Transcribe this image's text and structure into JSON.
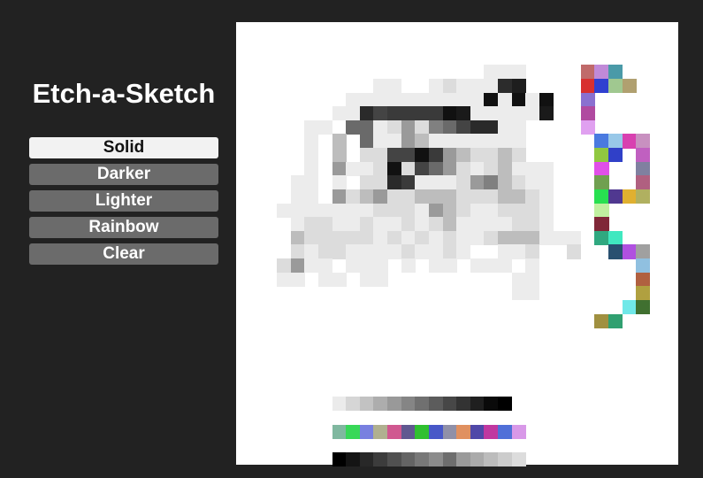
{
  "app": {
    "title": "Etch-a-Sketch"
  },
  "controls": {
    "buttons": [
      {
        "id": "solid",
        "label": "Solid",
        "active": true
      },
      {
        "id": "darker",
        "label": "Darker",
        "active": false
      },
      {
        "id": "lighter",
        "label": "Lighter",
        "active": false
      },
      {
        "id": "rainbow",
        "label": "Rainbow",
        "active": false
      },
      {
        "id": "clear",
        "label": "Clear",
        "active": false
      }
    ]
  },
  "colors": {
    "background": "#222222",
    "button": "#6b6b6b",
    "button_active": "#f2f2f2",
    "canvas": "#ffffff"
  },
  "grid": {
    "size": 32,
    "cells": [
      [
        15,
        2,
        "#ececec"
      ],
      [
        16,
        2,
        "#ececec"
      ],
      [
        17,
        2,
        "#ececec"
      ],
      [
        7,
        3,
        "#ececec"
      ],
      [
        8,
        3,
        "#ececec"
      ],
      [
        11,
        3,
        "#ececec"
      ],
      [
        12,
        3,
        "#dcdcdc"
      ],
      [
        13,
        3,
        "#ececec"
      ],
      [
        14,
        3,
        "#ececec"
      ],
      [
        15,
        3,
        "#ececec"
      ],
      [
        16,
        3,
        "#2c2c2c"
      ],
      [
        17,
        3,
        "#1e1e1e"
      ],
      [
        5,
        4,
        "#ececec"
      ],
      [
        6,
        4,
        "#ececec"
      ],
      [
        7,
        4,
        "#ececec"
      ],
      [
        8,
        4,
        "#ececec"
      ],
      [
        9,
        4,
        "#ececec"
      ],
      [
        10,
        4,
        "#ececec"
      ],
      [
        11,
        4,
        "#ececec"
      ],
      [
        12,
        4,
        "#ececec"
      ],
      [
        13,
        4,
        "#ececec"
      ],
      [
        14,
        4,
        "#ececec"
      ],
      [
        15,
        4,
        "#111111"
      ],
      [
        16,
        4,
        "#ececec"
      ],
      [
        17,
        4,
        "#111111"
      ],
      [
        18,
        4,
        "#ececec"
      ],
      [
        19,
        4,
        "#111111"
      ],
      [
        4,
        5,
        "#ececec"
      ],
      [
        5,
        5,
        "#ececec"
      ],
      [
        6,
        5,
        "#2a2a2a"
      ],
      [
        7,
        5,
        "#444444"
      ],
      [
        8,
        5,
        "#3a3a3a"
      ],
      [
        9,
        5,
        "#3a3a3a"
      ],
      [
        10,
        5,
        "#3a3a3a"
      ],
      [
        11,
        5,
        "#3a3a3a"
      ],
      [
        12,
        5,
        "#111111"
      ],
      [
        13,
        5,
        "#1a1a1a"
      ],
      [
        14,
        5,
        "#ececec"
      ],
      [
        15,
        5,
        "#ececec"
      ],
      [
        16,
        5,
        "#ececec"
      ],
      [
        17,
        5,
        "#ececec"
      ],
      [
        18,
        5,
        "#ececec"
      ],
      [
        19,
        5,
        "#1a1a1a"
      ],
      [
        2,
        6,
        "#ececec"
      ],
      [
        3,
        6,
        "#ececec"
      ],
      [
        5,
        6,
        "#6a6a6a"
      ],
      [
        6,
        6,
        "#6a6a6a"
      ],
      [
        7,
        6,
        "#ececec"
      ],
      [
        8,
        6,
        "#dcdcdc"
      ],
      [
        9,
        6,
        "#9a9a9a"
      ],
      [
        10,
        6,
        "#dcdcdc"
      ],
      [
        11,
        6,
        "#808080"
      ],
      [
        12,
        6,
        "#6a6a6a"
      ],
      [
        13,
        6,
        "#444444"
      ],
      [
        14,
        6,
        "#2a2a2a"
      ],
      [
        15,
        6,
        "#2a2a2a"
      ],
      [
        16,
        6,
        "#ececec"
      ],
      [
        17,
        6,
        "#ececec"
      ],
      [
        2,
        7,
        "#ececec"
      ],
      [
        4,
        7,
        "#bdbdbd"
      ],
      [
        6,
        7,
        "#6a6a6a"
      ],
      [
        7,
        7,
        "#ececec"
      ],
      [
        8,
        7,
        "#ececec"
      ],
      [
        9,
        7,
        "#9a9a9a"
      ],
      [
        10,
        7,
        "#bdbdbd"
      ],
      [
        11,
        7,
        "#ececec"
      ],
      [
        12,
        7,
        "#ececec"
      ],
      [
        13,
        7,
        "#ececec"
      ],
      [
        14,
        7,
        "#ececec"
      ],
      [
        15,
        7,
        "#ececec"
      ],
      [
        16,
        7,
        "#ececec"
      ],
      [
        17,
        7,
        "#ececec"
      ],
      [
        2,
        8,
        "#ececec"
      ],
      [
        4,
        8,
        "#bdbdbd"
      ],
      [
        6,
        8,
        "#dcdcdc"
      ],
      [
        7,
        8,
        "#dcdcdc"
      ],
      [
        8,
        8,
        "#444444"
      ],
      [
        9,
        8,
        "#444444"
      ],
      [
        10,
        8,
        "#111111"
      ],
      [
        11,
        8,
        "#3a3a3a"
      ],
      [
        12,
        8,
        "#9a9a9a"
      ],
      [
        13,
        8,
        "#bdbdbd"
      ],
      [
        14,
        8,
        "#dcdcdc"
      ],
      [
        15,
        8,
        "#dcdcdc"
      ],
      [
        16,
        8,
        "#bdbdbd"
      ],
      [
        17,
        8,
        "#dcdcdc"
      ],
      [
        2,
        9,
        "#ececec"
      ],
      [
        4,
        9,
        "#9a9a9a"
      ],
      [
        5,
        9,
        "#ececec"
      ],
      [
        6,
        9,
        "#ececec"
      ],
      [
        7,
        9,
        "#dcdcdc"
      ],
      [
        8,
        9,
        "#111111"
      ],
      [
        9,
        9,
        "#dcdcdc"
      ],
      [
        10,
        9,
        "#444444"
      ],
      [
        11,
        9,
        "#6a6a6a"
      ],
      [
        12,
        9,
        "#9a9a9a"
      ],
      [
        13,
        9,
        "#dcdcdc"
      ],
      [
        14,
        9,
        "#ececec"
      ],
      [
        15,
        9,
        "#dcdcdc"
      ],
      [
        16,
        9,
        "#bdbdbd"
      ],
      [
        17,
        9,
        "#ececec"
      ],
      [
        18,
        9,
        "#ececec"
      ],
      [
        19,
        9,
        "#ececec"
      ],
      [
        1,
        10,
        "#ececec"
      ],
      [
        2,
        10,
        "#ececec"
      ],
      [
        4,
        10,
        "#ececec"
      ],
      [
        6,
        10,
        "#dcdcdc"
      ],
      [
        7,
        10,
        "#dcdcdc"
      ],
      [
        8,
        10,
        "#2a2a2a"
      ],
      [
        9,
        10,
        "#3a3a3a"
      ],
      [
        10,
        10,
        "#ececec"
      ],
      [
        11,
        10,
        "#ececec"
      ],
      [
        12,
        10,
        "#ececec"
      ],
      [
        13,
        10,
        "#dcdcdc"
      ],
      [
        14,
        10,
        "#9a9a9a"
      ],
      [
        15,
        10,
        "#808080"
      ],
      [
        16,
        10,
        "#bdbdbd"
      ],
      [
        17,
        10,
        "#dcdcdc"
      ],
      [
        18,
        10,
        "#ececec"
      ],
      [
        19,
        10,
        "#ececec"
      ],
      [
        1,
        11,
        "#ececec"
      ],
      [
        2,
        11,
        "#ececec"
      ],
      [
        4,
        11,
        "#9a9a9a"
      ],
      [
        5,
        11,
        "#dcdcdc"
      ],
      [
        6,
        11,
        "#bdbdbd"
      ],
      [
        7,
        11,
        "#9a9a9a"
      ],
      [
        8,
        11,
        "#dcdcdc"
      ],
      [
        9,
        11,
        "#dcdcdc"
      ],
      [
        10,
        11,
        "#bdbdbd"
      ],
      [
        11,
        11,
        "#bdbdbd"
      ],
      [
        12,
        11,
        "#bdbdbd"
      ],
      [
        13,
        11,
        "#dcdcdc"
      ],
      [
        14,
        11,
        "#dcdcdc"
      ],
      [
        15,
        11,
        "#dcdcdc"
      ],
      [
        16,
        11,
        "#bdbdbd"
      ],
      [
        17,
        11,
        "#bdbdbd"
      ],
      [
        18,
        11,
        "#dcdcdc"
      ],
      [
        19,
        11,
        "#ececec"
      ],
      [
        0,
        12,
        "#ececec"
      ],
      [
        1,
        12,
        "#ececec"
      ],
      [
        2,
        12,
        "#ececec"
      ],
      [
        3,
        12,
        "#ececec"
      ],
      [
        4,
        12,
        "#ececec"
      ],
      [
        5,
        12,
        "#ececec"
      ],
      [
        6,
        12,
        "#ececec"
      ],
      [
        7,
        12,
        "#dcdcdc"
      ],
      [
        8,
        12,
        "#dcdcdc"
      ],
      [
        9,
        12,
        "#dcdcdc"
      ],
      [
        10,
        12,
        "#ececec"
      ],
      [
        11,
        12,
        "#9a9a9a"
      ],
      [
        12,
        12,
        "#bdbdbd"
      ],
      [
        13,
        12,
        "#dcdcdc"
      ],
      [
        14,
        12,
        "#ececec"
      ],
      [
        15,
        12,
        "#ececec"
      ],
      [
        16,
        12,
        "#dcdcdc"
      ],
      [
        17,
        12,
        "#dcdcdc"
      ],
      [
        18,
        12,
        "#dcdcdc"
      ],
      [
        19,
        12,
        "#ececec"
      ],
      [
        1,
        13,
        "#ececec"
      ],
      [
        2,
        13,
        "#dcdcdc"
      ],
      [
        3,
        13,
        "#dcdcdc"
      ],
      [
        4,
        13,
        "#ececec"
      ],
      [
        5,
        13,
        "#ececec"
      ],
      [
        6,
        13,
        "#dcdcdc"
      ],
      [
        7,
        13,
        "#ececec"
      ],
      [
        8,
        13,
        "#ececec"
      ],
      [
        9,
        13,
        "#dcdcdc"
      ],
      [
        10,
        13,
        "#ececec"
      ],
      [
        11,
        13,
        "#dcdcdc"
      ],
      [
        12,
        13,
        "#bdbdbd"
      ],
      [
        13,
        13,
        "#ececec"
      ],
      [
        14,
        13,
        "#ececec"
      ],
      [
        15,
        13,
        "#ececec"
      ],
      [
        16,
        13,
        "#ececec"
      ],
      [
        17,
        13,
        "#dcdcdc"
      ],
      [
        18,
        13,
        "#dcdcdc"
      ],
      [
        19,
        13,
        "#ececec"
      ],
      [
        1,
        14,
        "#bdbdbd"
      ],
      [
        2,
        14,
        "#dcdcdc"
      ],
      [
        3,
        14,
        "#dcdcdc"
      ],
      [
        4,
        14,
        "#dcdcdc"
      ],
      [
        5,
        14,
        "#dcdcdc"
      ],
      [
        6,
        14,
        "#dcdcdc"
      ],
      [
        7,
        14,
        "#ececec"
      ],
      [
        8,
        14,
        "#dcdcdc"
      ],
      [
        9,
        14,
        "#ececec"
      ],
      [
        10,
        14,
        "#dcdcdc"
      ],
      [
        11,
        14,
        "#ececec"
      ],
      [
        12,
        14,
        "#dcdcdc"
      ],
      [
        13,
        14,
        "#ececec"
      ],
      [
        14,
        14,
        "#ececec"
      ],
      [
        15,
        14,
        "#dcdcdc"
      ],
      [
        16,
        14,
        "#bdbdbd"
      ],
      [
        17,
        14,
        "#bdbdbd"
      ],
      [
        18,
        14,
        "#bdbdbd"
      ],
      [
        19,
        14,
        "#ececec"
      ],
      [
        20,
        14,
        "#ececec"
      ],
      [
        21,
        14,
        "#ececec"
      ],
      [
        1,
        15,
        "#dcdcdc"
      ],
      [
        2,
        15,
        "#ececec"
      ],
      [
        3,
        15,
        "#dcdcdc"
      ],
      [
        4,
        15,
        "#dcdcdc"
      ],
      [
        5,
        15,
        "#ececec"
      ],
      [
        6,
        15,
        "#ececec"
      ],
      [
        7,
        15,
        "#ececec"
      ],
      [
        8,
        15,
        "#ececec"
      ],
      [
        9,
        15,
        "#dcdcdc"
      ],
      [
        10,
        15,
        "#ececec"
      ],
      [
        11,
        15,
        "#ececec"
      ],
      [
        12,
        15,
        "#dcdcdc"
      ],
      [
        13,
        15,
        "#ececec"
      ],
      [
        16,
        15,
        "#ececec"
      ],
      [
        17,
        15,
        "#ececec"
      ],
      [
        18,
        15,
        "#dcdcdc"
      ],
      [
        21,
        15,
        "#dcdcdc"
      ],
      [
        0,
        16,
        "#dcdcdc"
      ],
      [
        1,
        16,
        "#9a9a9a"
      ],
      [
        2,
        16,
        "#ececec"
      ],
      [
        3,
        16,
        "#ececec"
      ],
      [
        5,
        16,
        "#ececec"
      ],
      [
        6,
        16,
        "#ececec"
      ],
      [
        7,
        16,
        "#ececec"
      ],
      [
        9,
        16,
        "#ececec"
      ],
      [
        11,
        16,
        "#ececec"
      ],
      [
        12,
        16,
        "#ececec"
      ],
      [
        14,
        16,
        "#ececec"
      ],
      [
        15,
        16,
        "#ececec"
      ],
      [
        16,
        16,
        "#ececec"
      ],
      [
        18,
        16,
        "#ececec"
      ],
      [
        0,
        17,
        "#ececec"
      ],
      [
        1,
        17,
        "#ececec"
      ],
      [
        3,
        17,
        "#ececec"
      ],
      [
        4,
        17,
        "#ececec"
      ],
      [
        6,
        17,
        "#ececec"
      ],
      [
        7,
        17,
        "#ececec"
      ],
      [
        17,
        17,
        "#ececec"
      ],
      [
        18,
        17,
        "#ececec"
      ],
      [
        17,
        18,
        "#ececec"
      ],
      [
        18,
        18,
        "#ececec"
      ],
      [
        22,
        2,
        "#c06a6a"
      ],
      [
        23,
        2,
        "#c08ad8"
      ],
      [
        24,
        2,
        "#4a9aa8"
      ],
      [
        22,
        3,
        "#d83030"
      ],
      [
        23,
        3,
        "#3040d0"
      ],
      [
        24,
        3,
        "#a0c890"
      ],
      [
        25,
        3,
        "#b0a070"
      ],
      [
        22,
        4,
        "#8a70d0"
      ],
      [
        22,
        5,
        "#b04aa0"
      ],
      [
        22,
        6,
        "#e0a0f0"
      ],
      [
        23,
        7,
        "#4a7ae0"
      ],
      [
        24,
        7,
        "#98c8e8"
      ],
      [
        25,
        7,
        "#d840b0"
      ],
      [
        26,
        7,
        "#c890c0"
      ],
      [
        23,
        8,
        "#90c840"
      ],
      [
        24,
        8,
        "#3040c8"
      ],
      [
        26,
        8,
        "#c060c0"
      ],
      [
        23,
        9,
        "#e050e8"
      ],
      [
        26,
        9,
        "#8080a0"
      ],
      [
        23,
        10,
        "#70a050"
      ],
      [
        26,
        10,
        "#b06080"
      ],
      [
        23,
        11,
        "#28e050"
      ],
      [
        24,
        11,
        "#503890"
      ],
      [
        25,
        11,
        "#e0b030"
      ],
      [
        26,
        11,
        "#b0b060"
      ],
      [
        23,
        12,
        "#c0f0a0"
      ],
      [
        23,
        13,
        "#802838"
      ],
      [
        23,
        14,
        "#30a880"
      ],
      [
        24,
        14,
        "#40e8c0"
      ],
      [
        24,
        15,
        "#285070"
      ],
      [
        25,
        15,
        "#b050e0"
      ],
      [
        26,
        15,
        "#a0a0a0"
      ],
      [
        26,
        16,
        "#90c0e0"
      ],
      [
        26,
        17,
        "#b06040"
      ],
      [
        26,
        18,
        "#b0a040"
      ],
      [
        25,
        19,
        "#70e8e8"
      ],
      [
        26,
        19,
        "#407030"
      ],
      [
        23,
        20,
        "#a09040"
      ],
      [
        24,
        20,
        "#30a070"
      ],
      [
        4,
        26,
        "#ebebeb"
      ],
      [
        5,
        26,
        "#d6d6d6"
      ],
      [
        6,
        26,
        "#c2c2c2"
      ],
      [
        7,
        26,
        "#adadad"
      ],
      [
        8,
        26,
        "#999999"
      ],
      [
        9,
        26,
        "#858585"
      ],
      [
        10,
        26,
        "#707070"
      ],
      [
        11,
        26,
        "#5c5c5c"
      ],
      [
        12,
        26,
        "#474747"
      ],
      [
        13,
        26,
        "#333333"
      ],
      [
        14,
        26,
        "#1f1f1f"
      ],
      [
        15,
        26,
        "#0a0a0a"
      ],
      [
        16,
        26,
        "#000000"
      ],
      [
        4,
        28,
        "#80b8a0"
      ],
      [
        5,
        28,
        "#38d858"
      ],
      [
        6,
        28,
        "#7880e0"
      ],
      [
        7,
        28,
        "#b0b090"
      ],
      [
        8,
        28,
        "#d05890"
      ],
      [
        9,
        28,
        "#605890"
      ],
      [
        10,
        28,
        "#30c030"
      ],
      [
        11,
        28,
        "#4858c8"
      ],
      [
        12,
        28,
        "#9090a8"
      ],
      [
        13,
        28,
        "#e09060"
      ],
      [
        14,
        28,
        "#5048a8"
      ],
      [
        15,
        28,
        "#c038a0"
      ],
      [
        16,
        28,
        "#5070d8"
      ],
      [
        17,
        28,
        "#d898e8"
      ],
      [
        4,
        30,
        "#000000"
      ],
      [
        5,
        30,
        "#141414"
      ],
      [
        6,
        30,
        "#282828"
      ],
      [
        7,
        30,
        "#3c3c3c"
      ],
      [
        8,
        30,
        "#505050"
      ],
      [
        9,
        30,
        "#646464"
      ],
      [
        10,
        30,
        "#787878"
      ],
      [
        11,
        30,
        "#8c8c8c"
      ],
      [
        12,
        30,
        "#6e6e6e"
      ],
      [
        13,
        30,
        "#9a9a9a"
      ],
      [
        14,
        30,
        "#aaaaaa"
      ],
      [
        15,
        30,
        "#bcbcbc"
      ],
      [
        16,
        30,
        "#cccccc"
      ],
      [
        17,
        30,
        "#dcdcdc"
      ]
    ]
  }
}
